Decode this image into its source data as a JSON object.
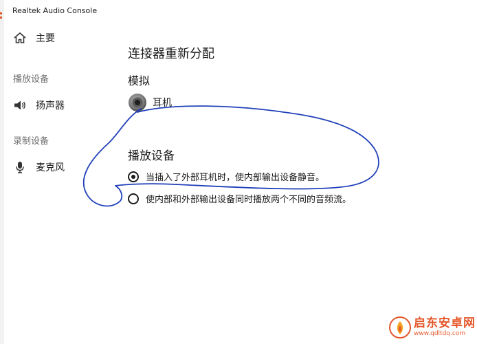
{
  "window": {
    "title": "Realtek Audio Console"
  },
  "sidebar": {
    "home": {
      "label": "主要",
      "icon": "home-icon"
    },
    "playback_header": "播放设备",
    "speaker": {
      "label": "扬声器",
      "icon": "speaker-icon"
    },
    "record_header": "录制设备",
    "microphone": {
      "label": "麦克风",
      "icon": "microphone-icon"
    }
  },
  "main": {
    "title": "连接器重新分配",
    "subtitle": "模拟",
    "jack": {
      "label": "耳机",
      "icon": "headphone-jack-icon"
    },
    "playback": {
      "title": "播放设备",
      "options": [
        {
          "label": "当插入了外部耳机时，使内部输出设备静音。",
          "selected": true
        },
        {
          "label": "使内部和外部输出设备同时播放两个不同的音频流。",
          "selected": false
        }
      ]
    }
  },
  "annotation": {
    "color": "#1f3fb8"
  },
  "watermark": {
    "brand": "启东安卓网",
    "url": "www.qdltdq.com",
    "color": "#e5572a"
  }
}
